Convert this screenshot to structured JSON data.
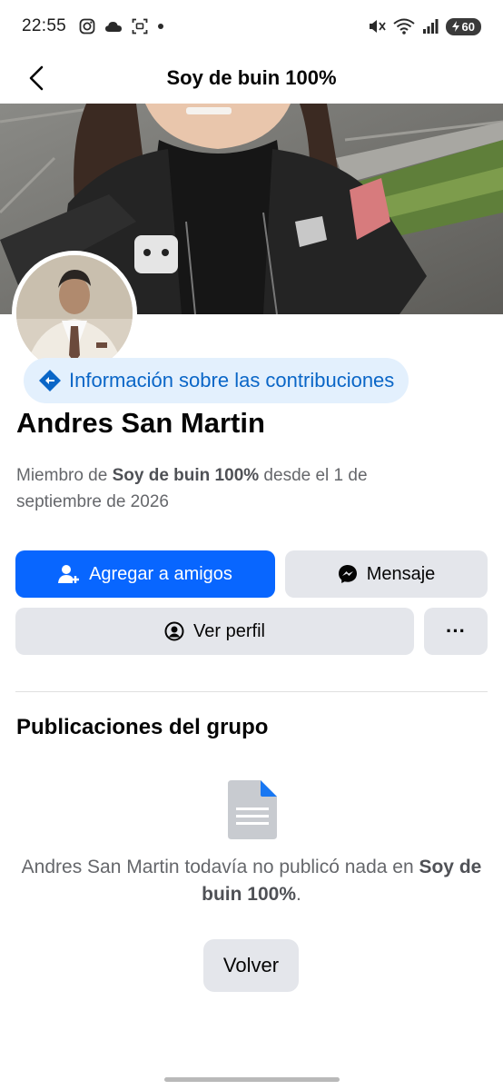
{
  "status_bar": {
    "time": "22:55",
    "battery": "60",
    "left_icons": [
      "instagram-icon",
      "cloud-icon",
      "screen-capture-icon",
      "dot-icon"
    ],
    "right_icons": [
      "mute-icon",
      "wifi-icon",
      "signal-icon",
      "battery-icon"
    ]
  },
  "nav": {
    "title": "Soy de buin 100%"
  },
  "contribution_pill": {
    "label": "Información sobre las contribuciones",
    "color": "#0a66c7"
  },
  "profile": {
    "name": "Andres San Martin",
    "member_prefix": "Miembro de ",
    "member_group": "Soy de buin 100%",
    "member_suffix": " desde el 1 de septiembre de 2026"
  },
  "actions": {
    "add_friend": "Agregar a amigos",
    "message": "Mensaje",
    "view_profile": "Ver perfil",
    "more": "···"
  },
  "group_posts": {
    "title": "Publicaciones del grupo",
    "empty_prefix": "Andres San Martin todavía no publicó nada en ",
    "empty_group": "Soy de buin 100%",
    "empty_suffix": ".",
    "back_button": "Volver"
  },
  "colors": {
    "primary": "#0866ff",
    "secondary_bg": "#e4e6eb",
    "muted_text": "#65676b"
  }
}
